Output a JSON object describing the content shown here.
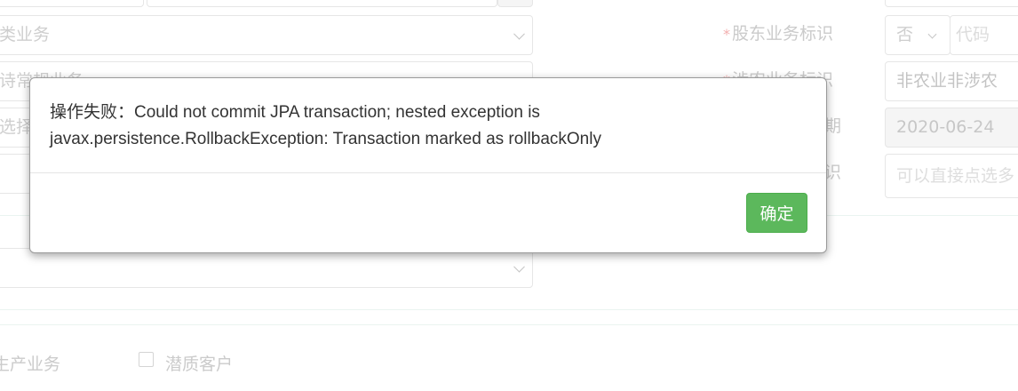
{
  "background": {
    "left_form": {
      "business_type_value": "类业务",
      "row2_partial_value": "诗常规业务",
      "row3_partial_label": "选择",
      "checkbox_label_production": "生产业务",
      "checkbox_label_potential": "潜质客户"
    },
    "right_form": {
      "shareholder_label": "股东业务标识",
      "shareholder_select_value": "否",
      "shareholder_code_placeholder": "代码",
      "agri_label": "涉农业务标识",
      "agri_value": "非农业非涉农",
      "date_label_partial": "期",
      "date_value": "2020-06-24",
      "tag_label_partial": "识",
      "tag_placeholder": "可以直接点选多"
    },
    "required_mark": "*"
  },
  "dialog": {
    "message_line1": "操作失败：Could not commit JPA transaction; nested exception is",
    "message_line2": "javax.persistence.RollbackException: Transaction marked as rollbackOnly",
    "ok_label": "确定",
    "ok_color": "#5cb85c"
  }
}
